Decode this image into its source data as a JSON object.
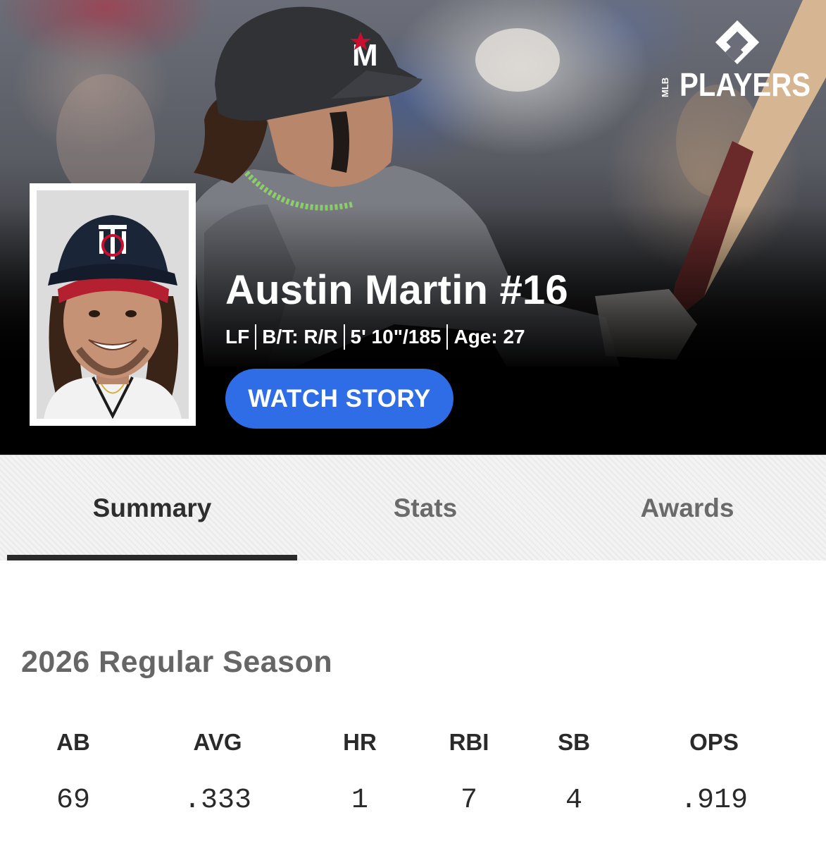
{
  "brand": {
    "logo_small_text": "MLB",
    "logo_text": "PLAYERS"
  },
  "player": {
    "name": "Austin Martin #16",
    "position": "LF",
    "bats_throws": "B/T: R/R",
    "height_weight": "5' 10\"/185",
    "age": "Age: 27"
  },
  "actions": {
    "watch_story_label": "WATCH STORY"
  },
  "tabs": [
    {
      "label": "Summary",
      "active": true
    },
    {
      "label": "Stats",
      "active": false
    },
    {
      "label": "Awards",
      "active": false
    }
  ],
  "season": {
    "title": "2026 Regular Season",
    "stats": [
      {
        "label": "AB",
        "value": "69"
      },
      {
        "label": "AVG",
        "value": ".333"
      },
      {
        "label": "HR",
        "value": "1"
      },
      {
        "label": "RBI",
        "value": "7"
      },
      {
        "label": "SB",
        "value": "4"
      },
      {
        "label": "OPS",
        "value": ".919"
      }
    ]
  },
  "colors": {
    "accent": "#2f6de6",
    "tab_active": "#2e2e2e",
    "tab_inactive": "#6a6a6a",
    "hero_background": "#000000"
  },
  "icons": {
    "brand": "mlb-players-logo",
    "helmet_letter": "M"
  }
}
